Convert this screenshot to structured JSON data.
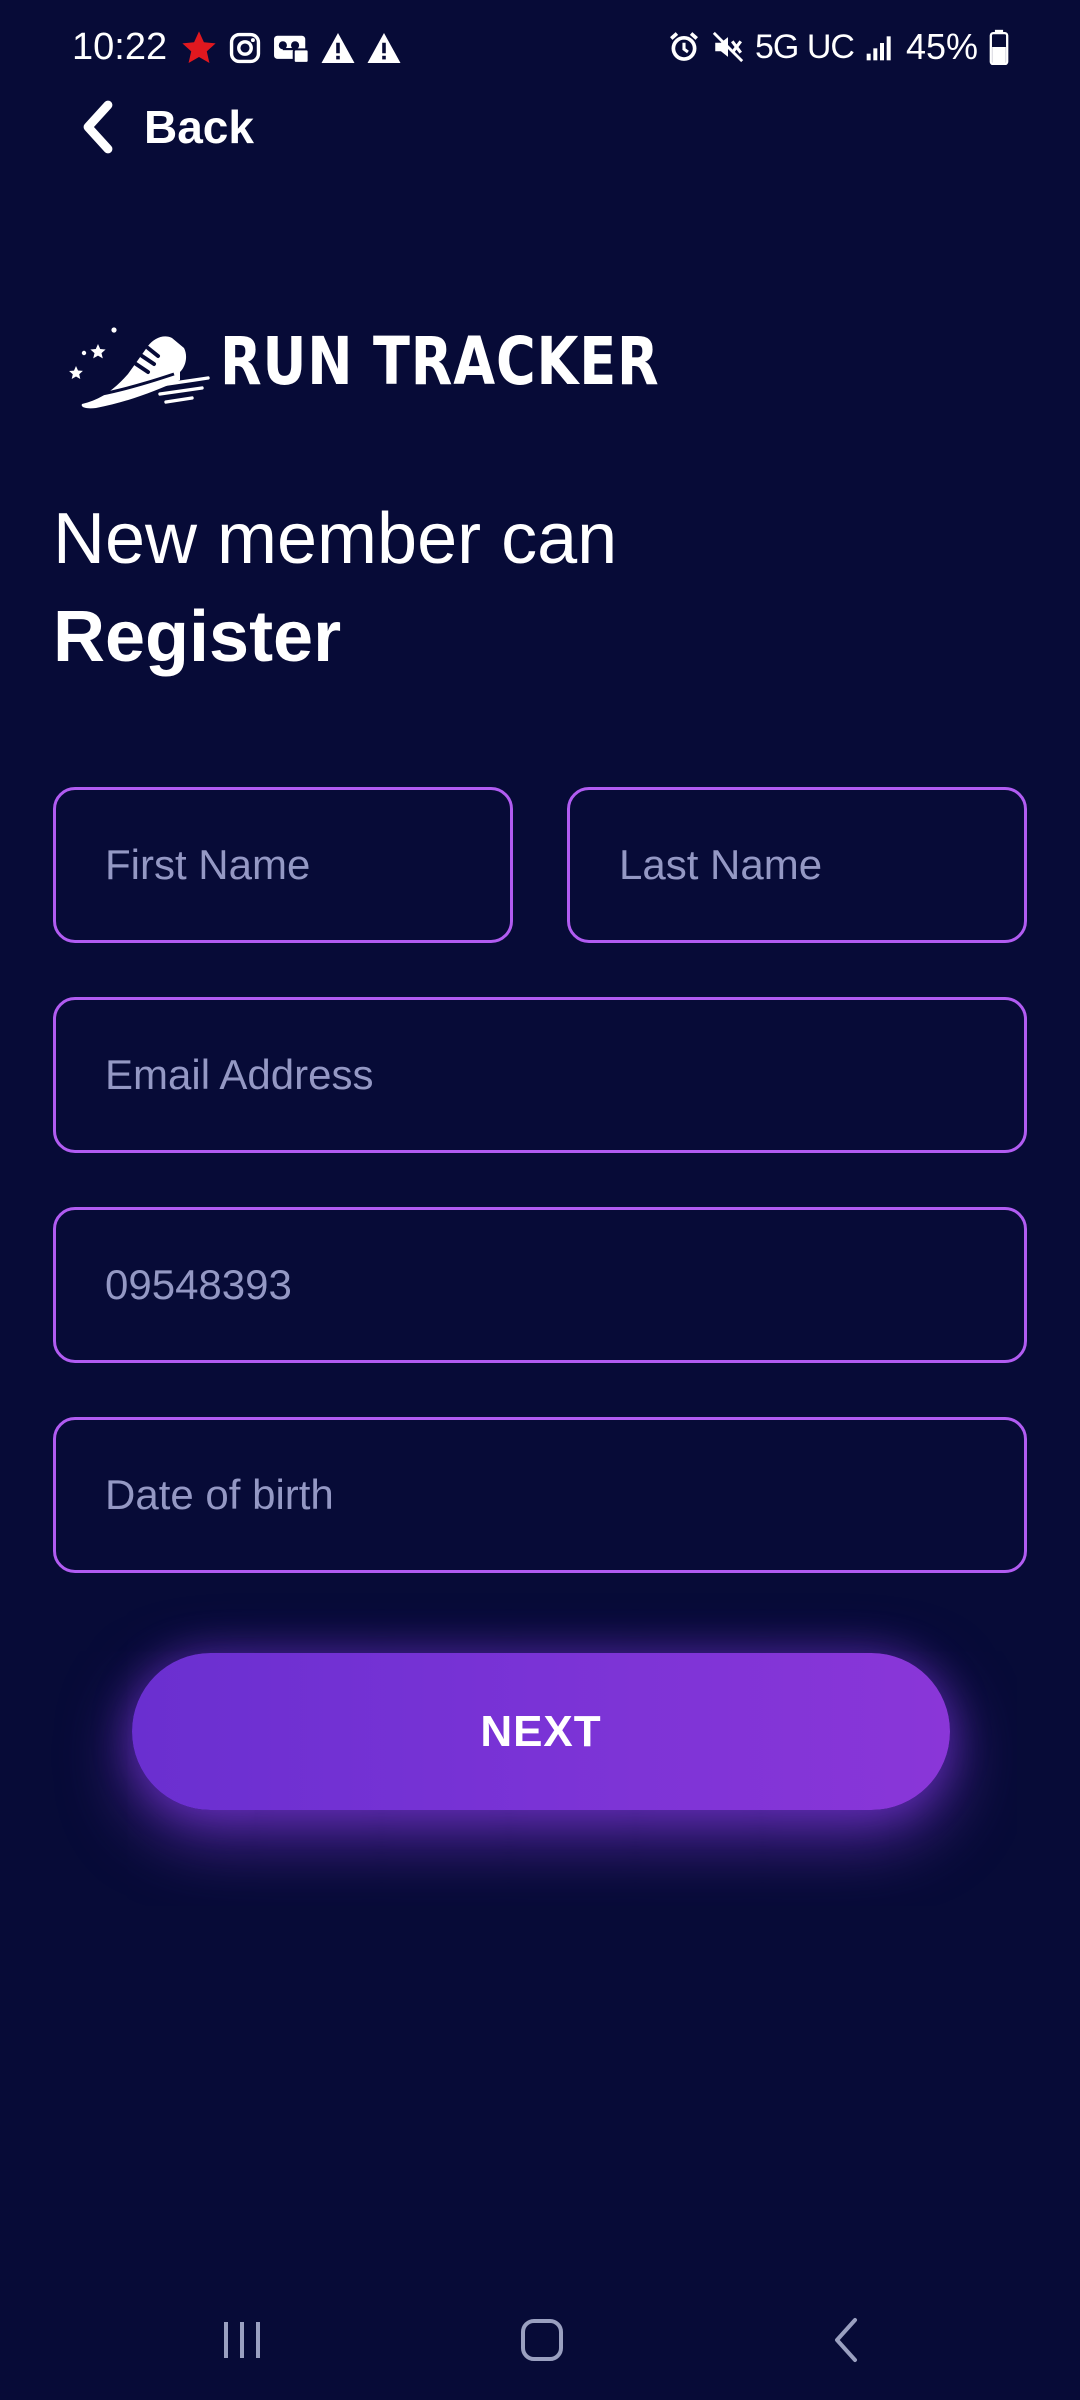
{
  "status_bar": {
    "time": "10:22",
    "network": "5G UC",
    "battery": "45%",
    "left_icons": [
      "star-icon",
      "instagram-icon",
      "voicemail-icon",
      "warning-icon",
      "warning-icon"
    ],
    "right_icons": [
      "alarm-icon",
      "mute-icon",
      "signal-icon",
      "battery-icon"
    ]
  },
  "header": {
    "back_label": "Back"
  },
  "logo": {
    "text": "RUN TRACKER",
    "icon": "running-shoe-icon"
  },
  "heading": {
    "line1": "New member can",
    "line2": "Register"
  },
  "form": {
    "first_name": {
      "placeholder": "First Name",
      "value": ""
    },
    "last_name": {
      "placeholder": "Last Name",
      "value": ""
    },
    "email": {
      "placeholder": "Email Address",
      "value": ""
    },
    "phone": {
      "placeholder": "09548393",
      "value": ""
    },
    "dob": {
      "placeholder": "Date of birth",
      "value": ""
    },
    "submit_label": "NEXT"
  },
  "nav_bar": {
    "items": [
      "recents-icon",
      "home-icon",
      "back-icon"
    ]
  },
  "colors": {
    "background": "#070b37",
    "field_border": "#b15cf2",
    "placeholder": "#9498c4",
    "button_start": "#6a2fd0",
    "button_end": "#8a36d8",
    "status_star": "#e0181f"
  }
}
